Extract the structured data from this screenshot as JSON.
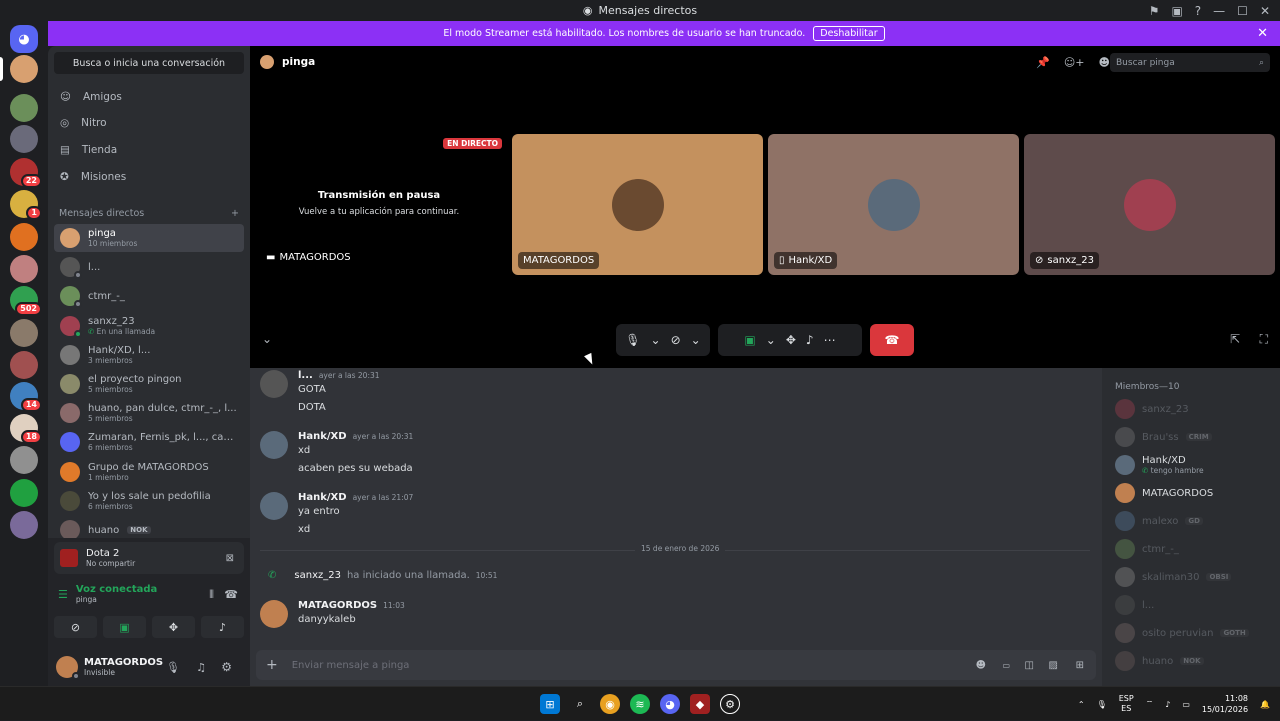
{
  "window": {
    "title": "Mensajes directos"
  },
  "banner": {
    "text": "El modo Streamer está habilitado. Los nombres de usuario se han truncado.",
    "button": "Deshabilitar"
  },
  "sidebar": {
    "search": "Busca o inicia una conversación",
    "nav": [
      {
        "label": "Amigos",
        "icon": "friends-icon"
      },
      {
        "label": "Nitro",
        "icon": "nitro-icon"
      },
      {
        "label": "Tienda",
        "icon": "shop-icon"
      },
      {
        "label": "Misiones",
        "icon": "quests-icon"
      }
    ],
    "dm_header": "Mensajes directos",
    "dms": [
      {
        "name": "pinga",
        "sub": "10 miembros"
      },
      {
        "name": "l...",
        "sub": ""
      },
      {
        "name": "ctmr_-_",
        "sub": ""
      },
      {
        "name": "sanxz_23",
        "sub": "En una llamada"
      },
      {
        "name": "Hank/XD, l...",
        "sub": "3 miembros"
      },
      {
        "name": "el proyecto pingon",
        "sub": "5 miembros"
      },
      {
        "name": "huano, pan dulce, ctmr_-_, l...",
        "sub": "5 miembros"
      },
      {
        "name": "Zumaran, Fernis_pk, l..., cami...",
        "sub": "6 miembros"
      },
      {
        "name": "Grupo de MATAGORDOS",
        "sub": "1 miembro"
      },
      {
        "name": "Yo y los sale un pedofilia",
        "sub": "6 miembros"
      },
      {
        "name": "huano",
        "sub": "",
        "tag": "NOK"
      }
    ]
  },
  "activity": {
    "game": "Dota 2",
    "status": "No compartir"
  },
  "voice": {
    "status": "Voz conectada",
    "channel": "pinga"
  },
  "user": {
    "name": "MATAGORDOS",
    "status": "Invisible"
  },
  "guild_badges": [
    "22",
    "1",
    "502",
    "14",
    "18"
  ],
  "call": {
    "header": "pinga",
    "search_placeholder": "Buscar pinga",
    "live": "EN DIRECTO",
    "paused_title": "Transmisión en pausa",
    "paused_sub": "Vuelve a tu aplicación para continuar.",
    "streamer": "MATAGORDOS",
    "tiles": [
      {
        "label": "MATAGORDOS"
      },
      {
        "label": "Hank/XD"
      },
      {
        "label": "sanxz_23"
      }
    ]
  },
  "chat": {
    "messages": [
      {
        "author": "l...",
        "time": "ayer a las 20:31",
        "lines": [
          "GOTA",
          "DOTA"
        ]
      },
      {
        "author": "Hank/XD",
        "time": "ayer a las 20:31",
        "lines": [
          "xd",
          "acaben pes su webada"
        ]
      },
      {
        "author": "Hank/XD",
        "time": "ayer a las 21:07",
        "lines": [
          "ya entro",
          "xd"
        ]
      }
    ],
    "date_divider": "15 de enero de 2026",
    "call_event": {
      "user": "sanxz_23",
      "text": "ha iniciado una llamada.",
      "time": "10:51"
    },
    "last": {
      "author": "MATAGORDOS",
      "time": "11:03",
      "line": "danyykaleb"
    },
    "composer_placeholder": "Enviar mensaje a pinga"
  },
  "members": {
    "header": "Miembros—10",
    "list": [
      {
        "name": "sanxz_23",
        "dim": true
      },
      {
        "name": "Brau'ss",
        "dim": true,
        "tag": "CRIM"
      },
      {
        "name": "Hank/XD",
        "dim": false,
        "sub": "tengo hambre"
      },
      {
        "name": "MATAGORDOS",
        "dim": false
      },
      {
        "name": "malexo",
        "dim": true,
        "tag": "GD"
      },
      {
        "name": "ctmr_-_",
        "dim": true
      },
      {
        "name": "skaliman30",
        "dim": true,
        "tag": "OBSI"
      },
      {
        "name": "l...",
        "dim": true
      },
      {
        "name": "osito peruvian",
        "dim": true,
        "tag": "GOTH"
      },
      {
        "name": "huano",
        "dim": true,
        "tag": "NOK"
      }
    ]
  },
  "taskbar": {
    "lang1": "ESP",
    "lang2": "ES",
    "time": "11:08",
    "date": "15/01/2026"
  }
}
